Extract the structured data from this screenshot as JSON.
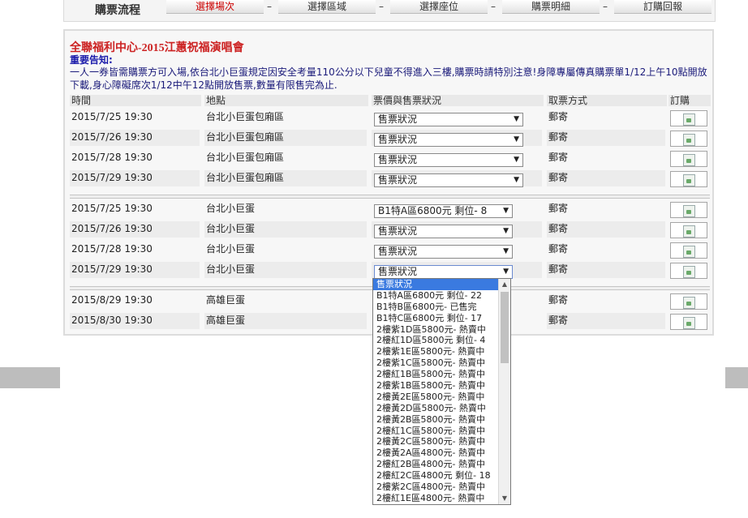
{
  "steps": {
    "title": "購票流程",
    "items": [
      "選擇場次",
      "選擇區域",
      "選擇座位",
      "購票明細",
      "訂購回報"
    ],
    "separator": "–"
  },
  "event": {
    "title": "全聯福利中心-2015江蕙祝福演唱會",
    "notice_label": "重要告知:",
    "notice_text": "一人一券皆需購票方可入場,依台北小巨蛋規定因安全考量110公分以下兒童不得進入三樓,購票時請特別注意!身障專屬傳真購票單1/12上午10點開放下載,身心障礙席次1/12中午12點開放售票,數量有限售完為止."
  },
  "table": {
    "headers": [
      "時間",
      "地點",
      "票價與售票狀況",
      "取票方式",
      "訂購"
    ],
    "groups": [
      [
        {
          "time": "2015/7/25 19:30",
          "venue": "台北小巨蛋包廂區",
          "status": "售票狀況",
          "pickup": "郵寄"
        },
        {
          "time": "2015/7/26 19:30",
          "venue": "台北小巨蛋包廂區",
          "status": "售票狀況",
          "pickup": "郵寄"
        },
        {
          "time": "2015/7/28 19:30",
          "venue": "台北小巨蛋包廂區",
          "status": "售票狀況",
          "pickup": "郵寄"
        },
        {
          "time": "2015/7/29 19:30",
          "venue": "台北小巨蛋包廂區",
          "status": "售票狀況",
          "pickup": "郵寄"
        }
      ],
      [
        {
          "time": "2015/7/25 19:30",
          "venue": "台北小巨蛋",
          "status": "B1特A區6800元 剩位- 8",
          "pickup": "郵寄"
        },
        {
          "time": "2015/7/26 19:30",
          "venue": "台北小巨蛋",
          "status": "售票狀況",
          "pickup": "郵寄"
        },
        {
          "time": "2015/7/28 19:30",
          "venue": "台北小巨蛋",
          "status": "售票狀況",
          "pickup": "郵寄"
        },
        {
          "time": "2015/7/29 19:30",
          "venue": "台北小巨蛋",
          "status": "售票狀況",
          "pickup": "郵寄"
        }
      ],
      [
        {
          "time": "2015/8/29 19:30",
          "venue": "高雄巨蛋",
          "status": "",
          "pickup": "郵寄"
        },
        {
          "time": "2015/8/30 19:30",
          "venue": "高雄巨蛋",
          "status": "",
          "pickup": "郵寄"
        }
      ]
    ]
  },
  "dropdown": {
    "options": [
      "售票狀況",
      "B1特A區6800元 剩位- 22",
      "B1特B區6800元- 已售完",
      "B1特C區6800元 剩位- 17",
      "2樓紫1D區5800元- 熱賣中",
      "2樓紅1D區5800元 剩位- 4",
      "2樓紫1E區5800元- 熱賣中",
      "2樓紫1C區5800元- 熱賣中",
      "2樓紅1B區5800元- 熱賣中",
      "2樓紫1B區5800元- 熱賣中",
      "2樓黃2E區5800元- 熱賣中",
      "2樓黃2D區5800元- 熱賣中",
      "2樓黃2B區5800元- 熱賣中",
      "2樓紅1C區5800元- 熱賣中",
      "2樓黃2C區5800元- 熱賣中",
      "2樓黃2A區4800元- 熱賣中",
      "2樓紅2B區4800元- 熱賣中",
      "2樓紅2C區4800元 剩位- 18",
      "2樓紫2C區4800元- 熱賣中",
      "2樓紅1E區4800元- 熱賣中"
    ]
  }
}
